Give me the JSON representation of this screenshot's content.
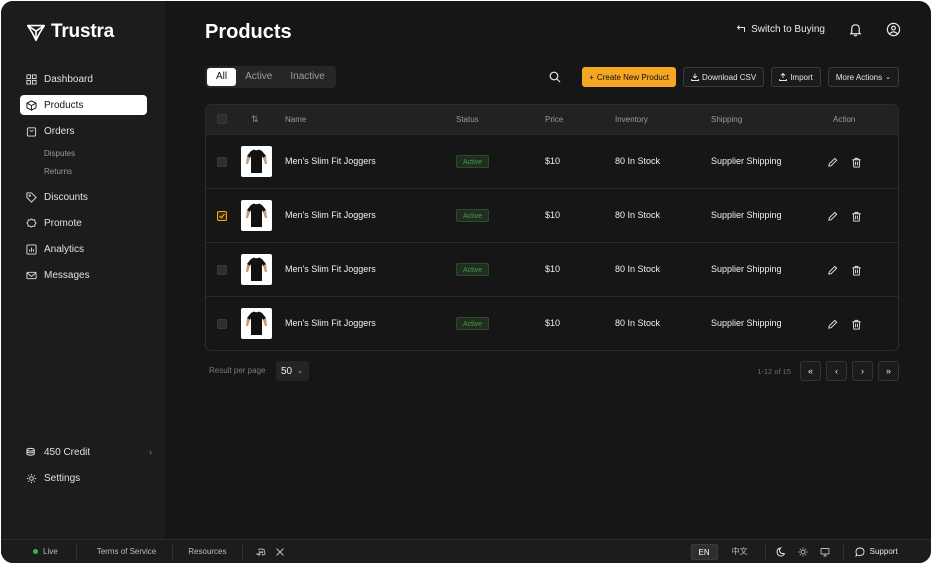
{
  "app": {
    "name": "Trustra"
  },
  "sidebar": {
    "items": [
      {
        "label": "Dashboard",
        "icon": "dashboard-icon"
      },
      {
        "label": "Products",
        "icon": "box-icon",
        "active": true
      },
      {
        "label": "Orders",
        "icon": "bag-icon"
      },
      {
        "label": "Discounts",
        "icon": "tag-icon"
      },
      {
        "label": "Promote",
        "icon": "badge-icon"
      },
      {
        "label": "Analytics",
        "icon": "chart-icon"
      },
      {
        "label": "Messages",
        "icon": "mail-icon"
      }
    ],
    "orders_sub": [
      "Disputes",
      "Returns"
    ],
    "credit_label": "450 Credit",
    "settings_label": "Settings"
  },
  "header": {
    "title": "Products",
    "switch_label": "Switch to Buying"
  },
  "tabs": [
    "All",
    "Active",
    "Inactive"
  ],
  "toolbar": {
    "create_label": "Create New Product",
    "download_label": "Download CSV",
    "import_label": "Import",
    "more_label": "More Actions"
  },
  "table": {
    "columns": [
      "Name",
      "Status",
      "Price",
      "Inventory",
      "Shipping",
      "Action"
    ],
    "rows": [
      {
        "name": "Men's Slim Fit Joggers",
        "status": "Active",
        "price": "$10",
        "inventory": "80 In Stock",
        "shipping": "Supplier Shipping",
        "checked": false
      },
      {
        "name": "Men's Slim Fit Joggers",
        "status": "Active",
        "price": "$10",
        "inventory": "80 In Stock",
        "shipping": "Supplier Shipping",
        "checked": true
      },
      {
        "name": "Men's Slim Fit Joggers",
        "status": "Active",
        "price": "$10",
        "inventory": "80 In Stock",
        "shipping": "Supplier Shipping",
        "checked": false
      },
      {
        "name": "Men's Slim Fit Joggers",
        "status": "Active",
        "price": "$10",
        "inventory": "80 In Stock",
        "shipping": "Supplier Shipping",
        "checked": false
      }
    ]
  },
  "pagination": {
    "per_page_label": "Result per page",
    "per_page_value": "50",
    "info": "1-12 of 15"
  },
  "footer": {
    "live_label": "Live",
    "terms_label": "Terms of Service",
    "resources_label": "Resources",
    "lang_en": "EN",
    "lang_zh": "中文",
    "support_label": "Support"
  },
  "colors": {
    "accent": "#f5a623",
    "status_active": "#4a9a4a",
    "background": "#161616"
  }
}
